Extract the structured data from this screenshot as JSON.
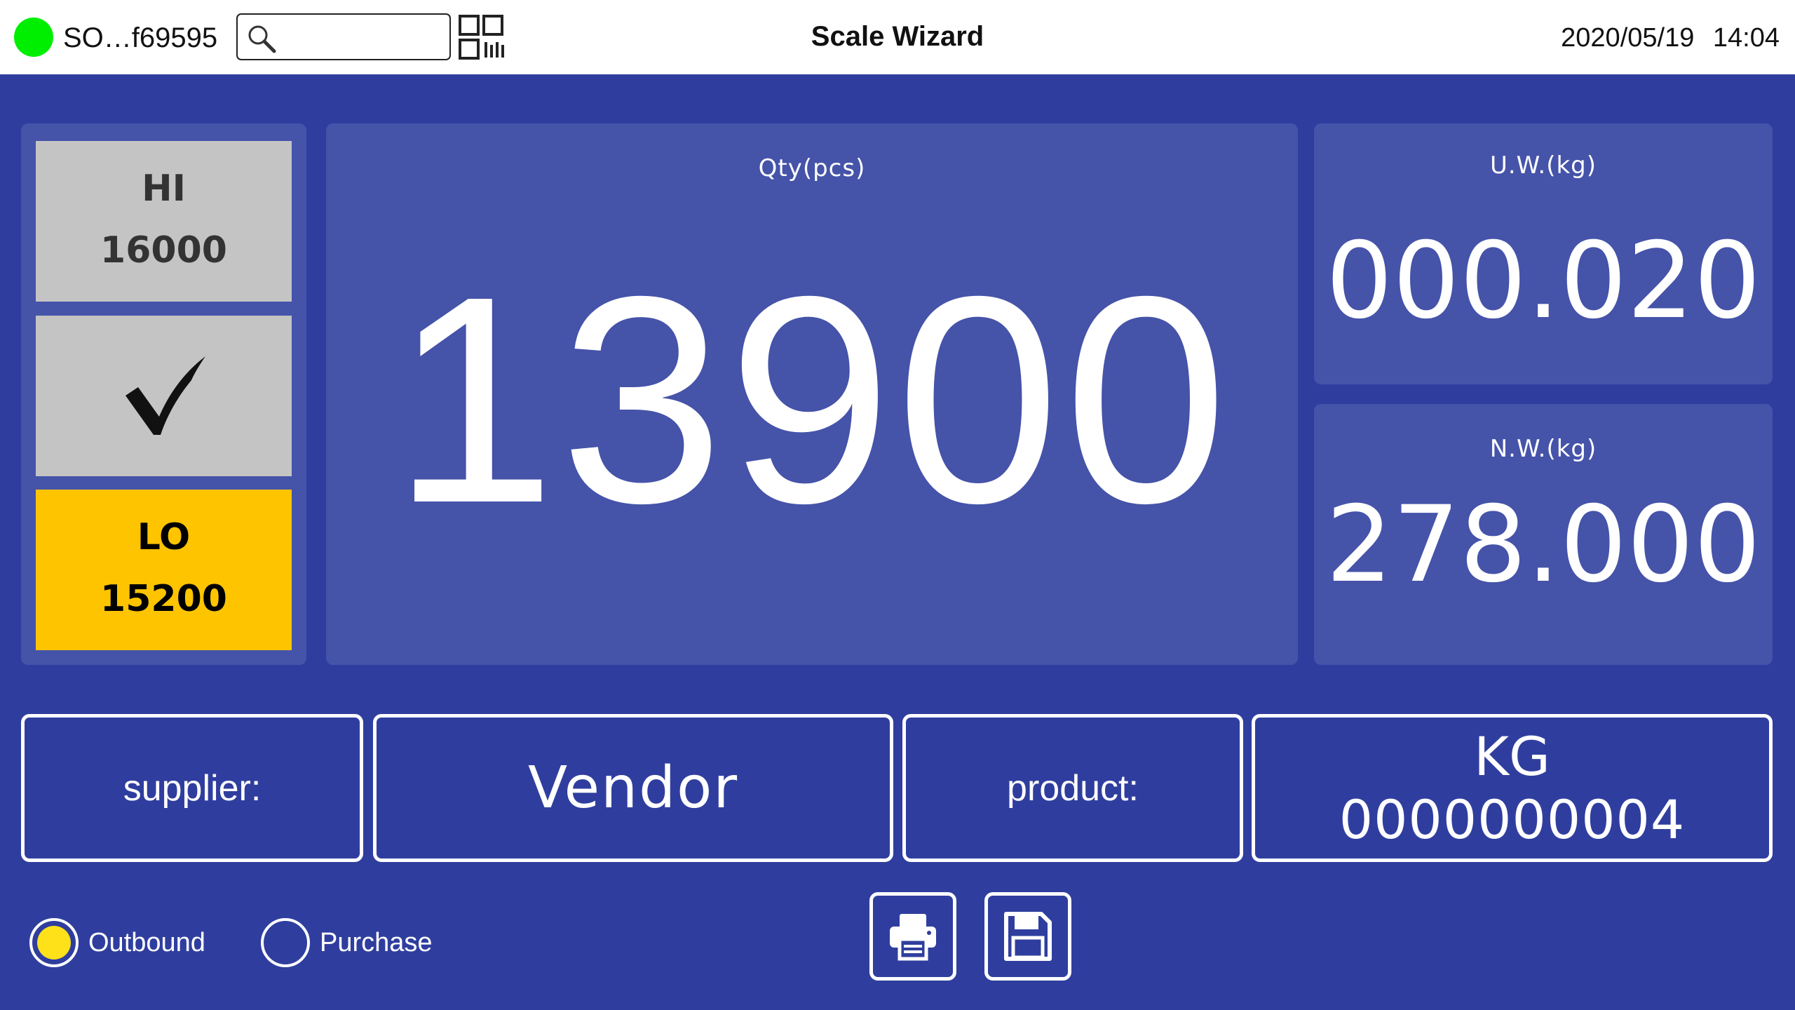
{
  "header": {
    "order_id": "SO…f69595",
    "search": {
      "value": "",
      "placeholder": ""
    },
    "title": "Scale Wizard",
    "date": "2020/05/19",
    "time": "14:04",
    "status_color": "#00ef00"
  },
  "limits": {
    "hi": {
      "label": "HI",
      "value": "16000"
    },
    "status": "check",
    "lo": {
      "label": "LO",
      "value": "15200",
      "color": "#ffc400"
    }
  },
  "quantity": {
    "label": "Qty(pcs)",
    "value": "13900"
  },
  "unit_weight": {
    "label": "U.W.(kg)",
    "value": "000.020"
  },
  "net_weight": {
    "label": "N.W.(kg)",
    "value": "278.000"
  },
  "supplier": {
    "label": "supplier:",
    "value": "Vendor"
  },
  "product": {
    "label": "product:",
    "name": "KG",
    "code": "0000000004"
  },
  "mode_options": [
    {
      "label": "Outbound",
      "selected": true
    },
    {
      "label": "Purchase",
      "selected": false
    }
  ],
  "actions": {
    "print_icon": "printer-icon",
    "save_icon": "floppy-disk-icon"
  },
  "colors": {
    "background": "#2f3e9e",
    "panel": "#4553a9",
    "radio_selected": "#ffe11a"
  }
}
